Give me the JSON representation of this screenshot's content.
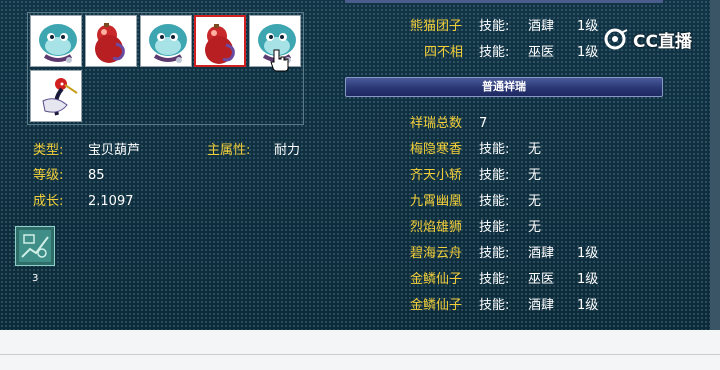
{
  "pet_grid": {
    "slots": [
      {
        "kind": "blue-whale-pet",
        "selected": false
      },
      {
        "kind": "red-gourd-pet",
        "selected": false
      },
      {
        "kind": "blue-whale-pet",
        "selected": false
      },
      {
        "kind": "red-gourd-pet",
        "selected": true
      },
      {
        "kind": "blue-whale-pet",
        "selected": false
      },
      {
        "kind": "crane-pet",
        "selected": false
      }
    ]
  },
  "details": {
    "type_label": "类型:",
    "type_value": "宝贝葫芦",
    "attr_label": "主属性:",
    "attr_value": "耐力",
    "level_label": "等级:",
    "level_value": "85",
    "growth_label": "成长:",
    "growth_value": "2.1097",
    "skill_count": "3"
  },
  "right_panel": {
    "top_rows": [
      {
        "name": "熊猫团子",
        "skill_label": "技能:",
        "skill": "酒肆",
        "level": "1级"
      },
      {
        "name": "四不相",
        "skill_label": "技能:",
        "skill": "巫医",
        "level": "1级"
      }
    ],
    "section_title": "普通祥瑞",
    "total_label": "祥瑞总数",
    "total_value": "7",
    "rows": [
      {
        "name": "梅隐寒香",
        "skill_label": "技能:",
        "skill": "无",
        "level": ""
      },
      {
        "name": "齐天小轿",
        "skill_label": "技能:",
        "skill": "无",
        "level": ""
      },
      {
        "name": "九霄幽凰",
        "skill_label": "技能:",
        "skill": "无",
        "level": ""
      },
      {
        "name": "烈焰雄狮",
        "skill_label": "技能:",
        "skill": "无",
        "level": ""
      },
      {
        "name": "碧海云舟",
        "skill_label": "技能:",
        "skill": "酒肆",
        "level": "1级"
      },
      {
        "name": "金鳞仙子",
        "skill_label": "技能:",
        "skill": "巫医",
        "level": "1级"
      },
      {
        "name": "金鳞仙子",
        "skill_label": "技能:",
        "skill": "酒肆",
        "level": "1级"
      }
    ]
  },
  "watermark": {
    "label": "CC直播"
  },
  "colors": {
    "label_gold": "#f2cf3a",
    "value_white": "#ffffff",
    "panel_bg": "#0f2e3d",
    "selected_border": "#d02020"
  }
}
